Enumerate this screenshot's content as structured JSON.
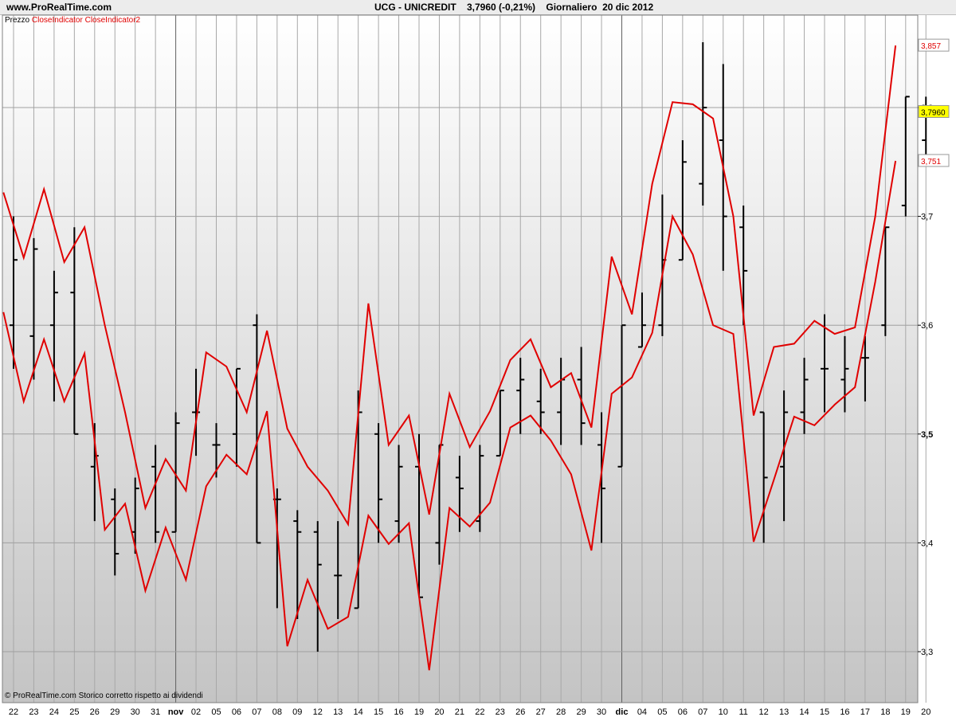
{
  "header": {
    "site": "www.ProRealTime.com",
    "title": "UCG - UNICREDIT    3,7960 (-0,21%)    Giornaliero  20 dic 2012"
  },
  "legend": {
    "price": "Prezzo",
    "ind1": "CloseIndicator",
    "ind2": "CloseIndicator2"
  },
  "footer": {
    "note": "© ProRealTime.com  Storico corretto rispetto ai dividendi"
  },
  "colors": {
    "bars": "#000000",
    "indicator": "#e00000",
    "last_price_bg": "#ffff00",
    "grid": "#a0a0a0"
  },
  "chart_data": {
    "type": "ohlc",
    "ylim": [
      3.25,
      3.88
    ],
    "yticks": [
      "3,3",
      "3,4",
      "3,5",
      "3,6",
      "3,7",
      "3,8"
    ],
    "price_tags": {
      "upper": "3,857",
      "last": "3,7960",
      "lower": "3,751"
    },
    "x_labels": [
      "22",
      "23",
      "24",
      "25",
      "26",
      "29",
      "30",
      "31",
      "nov",
      "02",
      "05",
      "06",
      "07",
      "08",
      "09",
      "12",
      "13",
      "14",
      "15",
      "16",
      "19",
      "20",
      "21",
      "22",
      "23",
      "26",
      "27",
      "28",
      "29",
      "30",
      "dic",
      "04",
      "05",
      "06",
      "07",
      "10",
      "11",
      "12",
      "13",
      "14",
      "15",
      "16",
      "17",
      "18",
      "19",
      "20"
    ],
    "month_separators": [
      "nov",
      "dic"
    ],
    "ohlc": [
      {
        "o": 3.6,
        "h": 3.7,
        "l": 3.56,
        "c": 3.66
      },
      {
        "o": 3.59,
        "h": 3.68,
        "l": 3.55,
        "c": 3.67
      },
      {
        "o": 3.6,
        "h": 3.65,
        "l": 3.53,
        "c": 3.63
      },
      {
        "o": 3.63,
        "h": 3.69,
        "l": 3.5,
        "c": 3.5
      },
      {
        "o": 3.47,
        "h": 3.51,
        "l": 3.42,
        "c": 3.48
      },
      {
        "o": 3.44,
        "h": 3.45,
        "l": 3.37,
        "c": 3.39
      },
      {
        "o": 3.41,
        "h": 3.46,
        "l": 3.39,
        "c": 3.45
      },
      {
        "o": 3.47,
        "h": 3.49,
        "l": 3.4,
        "c": 3.41
      },
      {
        "o": 3.41,
        "h": 3.52,
        "l": 3.41,
        "c": 3.51
      },
      {
        "o": 3.52,
        "h": 3.56,
        "l": 3.48,
        "c": 3.52
      },
      {
        "o": 3.49,
        "h": 3.51,
        "l": 3.46,
        "c": 3.49
      },
      {
        "o": 3.5,
        "h": 3.56,
        "l": 3.47,
        "c": 3.56
      },
      {
        "o": 3.6,
        "h": 3.61,
        "l": 3.4,
        "c": 3.4
      },
      {
        "o": 3.44,
        "h": 3.45,
        "l": 3.34,
        "c": 3.44
      },
      {
        "o": 3.42,
        "h": 3.43,
        "l": 3.33,
        "c": 3.41
      },
      {
        "o": 3.41,
        "h": 3.42,
        "l": 3.3,
        "c": 3.38
      },
      {
        "o": 3.37,
        "h": 3.42,
        "l": 3.33,
        "c": 3.37
      },
      {
        "o": 3.34,
        "h": 3.54,
        "l": 3.34,
        "c": 3.52
      },
      {
        "o": 3.5,
        "h": 3.51,
        "l": 3.4,
        "c": 3.44
      },
      {
        "o": 3.42,
        "h": 3.49,
        "l": 3.4,
        "c": 3.47
      },
      {
        "o": 3.47,
        "h": 3.5,
        "l": 3.35,
        "c": 3.35
      },
      {
        "o": 3.4,
        "h": 3.49,
        "l": 3.38,
        "c": 3.49
      },
      {
        "o": 3.46,
        "h": 3.48,
        "l": 3.41,
        "c": 3.45
      },
      {
        "o": 3.42,
        "h": 3.49,
        "l": 3.41,
        "c": 3.48
      },
      {
        "o": 3.48,
        "h": 3.54,
        "l": 3.48,
        "c": 3.54
      },
      {
        "o": 3.54,
        "h": 3.57,
        "l": 3.5,
        "c": 3.55
      },
      {
        "o": 3.53,
        "h": 3.56,
        "l": 3.5,
        "c": 3.52
      },
      {
        "o": 3.52,
        "h": 3.57,
        "l": 3.49,
        "c": 3.55
      },
      {
        "o": 3.55,
        "h": 3.58,
        "l": 3.49,
        "c": 3.51
      },
      {
        "o": 3.49,
        "h": 3.52,
        "l": 3.4,
        "c": 3.45
      },
      {
        "o": 3.47,
        "h": 3.6,
        "l": 3.47,
        "c": 3.6
      },
      {
        "o": 3.58,
        "h": 3.63,
        "l": 3.58,
        "c": 3.6
      },
      {
        "o": 3.6,
        "h": 3.72,
        "l": 3.59,
        "c": 3.66
      },
      {
        "o": 3.66,
        "h": 3.77,
        "l": 3.66,
        "c": 3.75
      },
      {
        "o": 3.73,
        "h": 3.86,
        "l": 3.71,
        "c": 3.8
      },
      {
        "o": 3.77,
        "h": 3.84,
        "l": 3.65,
        "c": 3.7
      },
      {
        "o": 3.69,
        "h": 3.71,
        "l": 3.6,
        "c": 3.65
      },
      {
        "o": 3.52,
        "h": 3.52,
        "l": 3.4,
        "c": 3.46
      },
      {
        "o": 3.47,
        "h": 3.54,
        "l": 3.42,
        "c": 3.52
      },
      {
        "o": 3.52,
        "h": 3.57,
        "l": 3.5,
        "c": 3.55
      },
      {
        "o": 3.56,
        "h": 3.61,
        "l": 3.52,
        "c": 3.56
      },
      {
        "o": 3.55,
        "h": 3.59,
        "l": 3.52,
        "c": 3.56
      },
      {
        "o": 3.57,
        "h": 3.59,
        "l": 3.53,
        "c": 3.57
      },
      {
        "o": 3.6,
        "h": 3.69,
        "l": 3.59,
        "c": 3.69
      },
      {
        "o": 3.71,
        "h": 3.81,
        "l": 3.7,
        "c": 3.81
      },
      {
        "o": 3.77,
        "h": 3.81,
        "l": 3.75,
        "c": 3.8
      }
    ],
    "series": [
      {
        "name": "CloseIndicator",
        "values": [
          3.722,
          3.662,
          3.725,
          3.658,
          3.69,
          3.6,
          3.52,
          3.432,
          3.477,
          3.448,
          3.575,
          3.562,
          3.52,
          3.595,
          3.505,
          3.47,
          3.448,
          3.417,
          3.62,
          3.49,
          3.517,
          3.426,
          3.537,
          3.488,
          3.521,
          3.568,
          3.587,
          3.543,
          3.556,
          3.506,
          3.663,
          3.61,
          3.73,
          3.805,
          3.803,
          3.79,
          3.7,
          3.517,
          3.58,
          3.583,
          3.604,
          3.592,
          3.598,
          3.7,
          3.857
        ]
      },
      {
        "name": "CloseIndicator2",
        "values": [
          3.612,
          3.53,
          3.587,
          3.53,
          3.574,
          3.412,
          3.436,
          3.356,
          3.414,
          3.366,
          3.452,
          3.481,
          3.463,
          3.521,
          3.305,
          3.366,
          3.321,
          3.332,
          3.425,
          3.399,
          3.418,
          3.283,
          3.432,
          3.415,
          3.437,
          3.506,
          3.517,
          3.494,
          3.463,
          3.393,
          3.537,
          3.552,
          3.593,
          3.7,
          3.665,
          3.6,
          3.592,
          3.401,
          3.458,
          3.516,
          3.508,
          3.527,
          3.543,
          3.64,
          3.751
        ]
      }
    ]
  }
}
